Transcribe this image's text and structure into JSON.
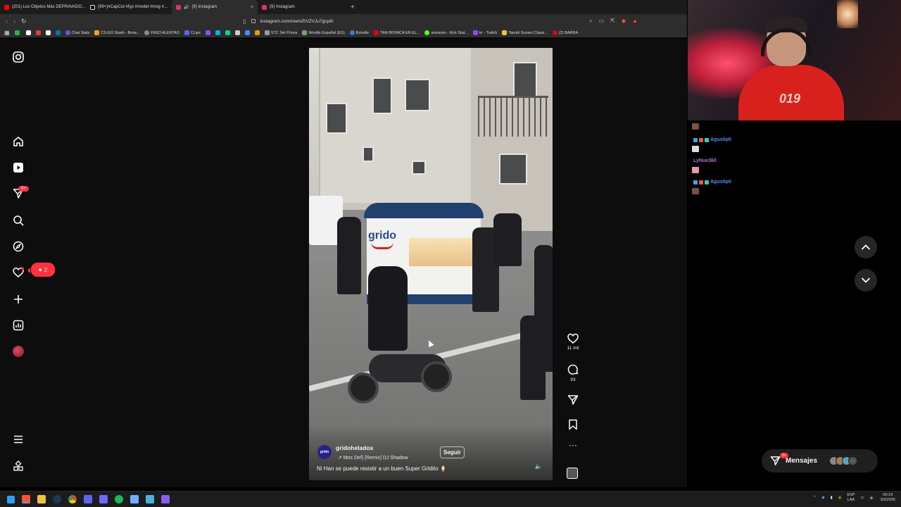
{
  "browser": {
    "tabs": [
      {
        "title": "(201) Los Objetos Más DEPRAVADO...",
        "favicon_color": "#ff0000"
      },
      {
        "title": "(99+)#CapCut #fyp #model #mog #...",
        "favicon_color": "#111111"
      },
      {
        "title": "(9) Instagram",
        "favicon_color": "#e1306c",
        "active": true
      },
      {
        "title": "(9) Instagram",
        "favicon_color": "#e1306c"
      }
    ],
    "close_glyph": "×",
    "new_tab_glyph": "+",
    "url": "instagram.com/reels/DVZVJu7gcp8/",
    "bookmarks": [
      {
        "label": "",
        "color": "#2bb34a"
      },
      {
        "label": "",
        "color": "#ffffff"
      },
      {
        "label": "",
        "color": "#e03e3e"
      },
      {
        "label": "",
        "color": "#ffffff"
      },
      {
        "label": "",
        "color": "#0077b5"
      },
      {
        "label": "Chat Stats",
        "color": "#6a5acd"
      },
      {
        "label": "CS:GO Stash - Brow...",
        "color": "#f0a020"
      },
      {
        "label": "FEED ALERTAS",
        "color": "#888888"
      },
      {
        "label": "CLips",
        "color": "#5865f2"
      },
      {
        "label": "",
        "color": "#9146ff"
      },
      {
        "label": "",
        "color": "#00b0e0"
      },
      {
        "label": "",
        "color": "#00d1a0"
      },
      {
        "label": "",
        "color": "#cccccc"
      },
      {
        "label": "",
        "color": "#4a8cff"
      },
      {
        "label": "",
        "color": "#e0a000"
      },
      {
        "label": "STC Set Prices",
        "color": "#999999"
      },
      {
        "label": "Wordle Español (ES)",
        "color": "#6aaa64"
      },
      {
        "label": "Boludle",
        "color": "#3a7bd5"
      },
      {
        "label": "TAN BIONICA EN EL...",
        "color": "#e0001b"
      },
      {
        "label": "sionaron - Kick Stat...",
        "color": "#53fc18"
      },
      {
        "label": "trr - Twitch",
        "color": "#9146ff"
      },
      {
        "label": "Tanuki Sunset Classi...",
        "color": "#f0c040"
      },
      {
        "label": "(2) BARRA",
        "color": "#e0001b"
      }
    ]
  },
  "instagram": {
    "nav_badge": "9+",
    "notification_count": "2",
    "reel": {
      "brand_on_cart": "grido",
      "account_avatar_text": "grido",
      "username": "gridohelados",
      "music": "Mos Def) [Remix]  DJ Shadow",
      "follow_label": "Seguir",
      "caption": "Ni Han se puede resistir a un buen Super Gridito 🍦",
      "likes": "11 mil",
      "comments": "93"
    },
    "messages": {
      "label": "Mensajes",
      "badge": "9+"
    }
  },
  "stream_overlay": {
    "chat": [
      {
        "user": "Agustip0",
        "color": "#4d8df0"
      },
      {
        "user": "LyNux360",
        "color": "#b76ee8"
      },
      {
        "user": "Agustip0",
        "color": "#4d8df0"
      }
    ],
    "cam_logo": "019"
  },
  "taskbar": {
    "lang_top": "ESP",
    "lang_bottom": "LAA",
    "time": "00:19",
    "date": "3/3/2026"
  }
}
